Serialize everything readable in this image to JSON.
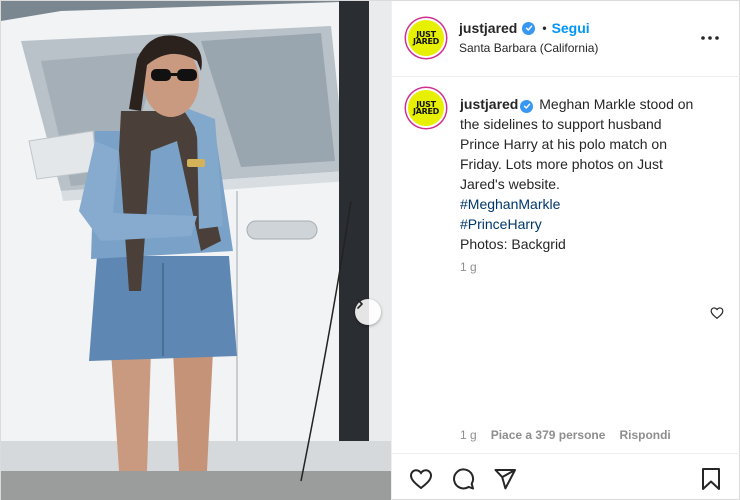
{
  "post": {
    "username": "justjared",
    "follow_label": "Segui",
    "separator": "•",
    "location": "Santa Barbara (California)",
    "avatar_logo_line1": "JUST",
    "avatar_logo_line2": "JARED",
    "caption": {
      "username": "justjared",
      "lines": [
        "Meghan Markle stood on",
        "the sidelines to support husband",
        "Prince Harry at his polo match on",
        "Friday. Lots more photos on Just",
        "Jared's website."
      ],
      "hashtags": [
        "#MeghanMarkle",
        "#PrinceHarry"
      ],
      "credit": "Photos: Backgrid",
      "age": "1 g"
    },
    "meta": {
      "age": "1 g",
      "likes": "Piace a 379 persone",
      "reply": "Rispondi"
    }
  },
  "icons": {
    "more": "more-options-icon",
    "verified": "verified-badge-icon",
    "next": "chevron-right-icon",
    "like": "heart-icon",
    "comment": "comment-icon",
    "share": "send-icon",
    "save": "bookmark-icon"
  },
  "colors": {
    "accent": "#0095f6",
    "hashtag": "#00376b",
    "verified": "#3897f0",
    "avatar_bg": "#e6f000",
    "muted": "#8e8e8e"
  }
}
